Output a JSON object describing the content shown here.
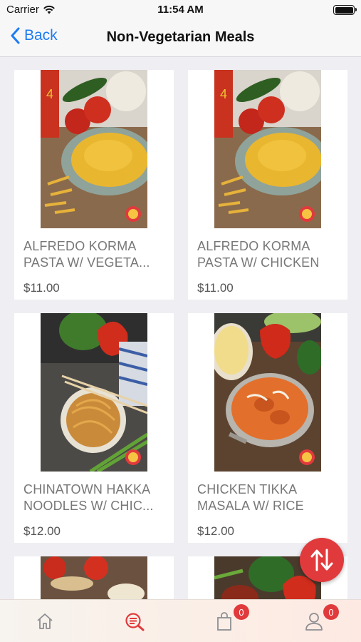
{
  "status_bar": {
    "carrier": "Carrier",
    "time": "11:54 AM"
  },
  "nav": {
    "back_label": "Back",
    "title": "Non-Vegetarian Meals"
  },
  "products": [
    {
      "name_line1": "ALFREDO KORMA",
      "name_line2": "PASTA W/ VEGETA...",
      "price": "$11.00"
    },
    {
      "name_line1": "ALFREDO KORMA",
      "name_line2": "PASTA W/ CHICKEN",
      "price": "$11.00"
    },
    {
      "name_line1": "CHINATOWN HAKKA",
      "name_line2": "NOODLES W/ CHIC...",
      "price": "$12.00"
    },
    {
      "name_line1": "CHICKEN TIKKA",
      "name_line2": "MASALA W/ RICE",
      "price": "$12.00"
    }
  ],
  "tab_bar": {
    "tabs": [
      {
        "icon": "home-icon"
      },
      {
        "icon": "search-menu-icon",
        "active": true
      },
      {
        "icon": "shopping-bag-icon",
        "badge": "0"
      },
      {
        "icon": "profile-icon",
        "badge": "0"
      }
    ]
  },
  "colors": {
    "accent": "#e13a3c",
    "link": "#1e7cf2"
  }
}
